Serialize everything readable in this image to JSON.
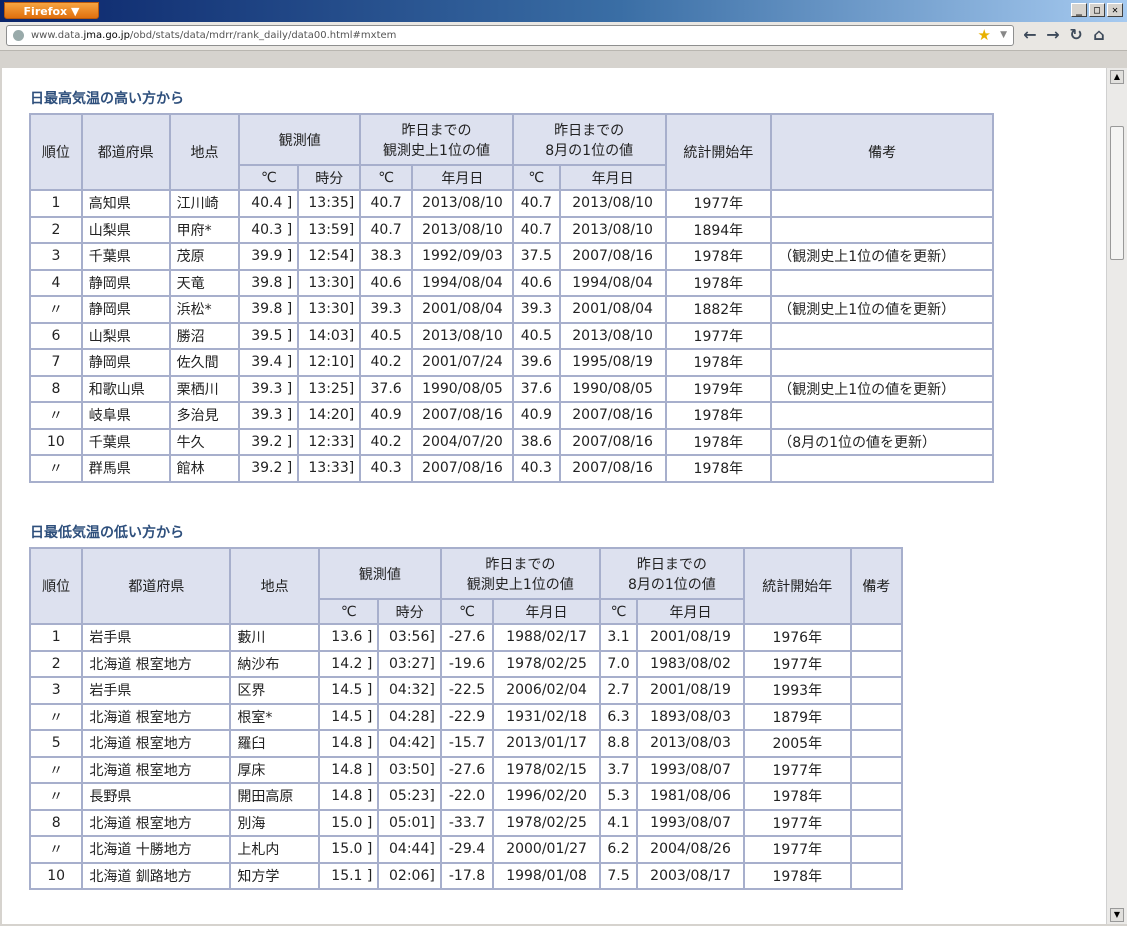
{
  "browser": {
    "button_label": "Firefox ▼",
    "window_buttons": [
      "_",
      "□",
      "✕"
    ],
    "url_prefix": "www.data.",
    "url_host": "jma.go.jp",
    "url_path": "/obd/stats/data/mdrr/rank_daily/data00.html#mxtem",
    "nav_icons": [
      "back-icon",
      "forward-icon",
      "reload-icon",
      "home-icon"
    ]
  },
  "headers": {
    "rank": "順位",
    "pref": "都道府県",
    "station": "地点",
    "observed": "観測値",
    "record_all_1": "昨日までの",
    "record_all_2": "観測史上1位の値",
    "record_aug_1": "昨日までの",
    "record_aug_2": "8月の1位の値",
    "start_year": "統計開始年",
    "remarks": "備考",
    "unit_c": "℃",
    "time": "時分",
    "date": "年月日"
  },
  "max_table": {
    "title": "日最高気温の高い方から",
    "rows": [
      {
        "rank": "1",
        "pref": "高知県",
        "station": "江川崎",
        "temp": "40.4 ]",
        "time": "13:35]",
        "rec_t": "40.7",
        "rec_d": "2013/08/10",
        "aug_t": "40.7",
        "aug_d": "2013/08/10",
        "start": "1977年",
        "note": ""
      },
      {
        "rank": "2",
        "pref": "山梨県",
        "station": "甲府*",
        "temp": "40.3 ]",
        "time": "13:59]",
        "rec_t": "40.7",
        "rec_d": "2013/08/10",
        "aug_t": "40.7",
        "aug_d": "2013/08/10",
        "start": "1894年",
        "note": ""
      },
      {
        "rank": "3",
        "pref": "千葉県",
        "station": "茂原",
        "temp": "39.9 ]",
        "time": "12:54]",
        "rec_t": "38.3",
        "rec_d": "1992/09/03",
        "aug_t": "37.5",
        "aug_d": "2007/08/16",
        "start": "1978年",
        "note": "（観測史上1位の値を更新）"
      },
      {
        "rank": "4",
        "pref": "静岡県",
        "station": "天竜",
        "temp": "39.8 ]",
        "time": "13:30]",
        "rec_t": "40.6",
        "rec_d": "1994/08/04",
        "aug_t": "40.6",
        "aug_d": "1994/08/04",
        "start": "1978年",
        "note": ""
      },
      {
        "rank": "〃",
        "pref": "静岡県",
        "station": "浜松*",
        "temp": "39.8 ]",
        "time": "13:30]",
        "rec_t": "39.3",
        "rec_d": "2001/08/04",
        "aug_t": "39.3",
        "aug_d": "2001/08/04",
        "start": "1882年",
        "note": "（観測史上1位の値を更新）"
      },
      {
        "rank": "6",
        "pref": "山梨県",
        "station": "勝沼",
        "temp": "39.5 ]",
        "time": "14:03]",
        "rec_t": "40.5",
        "rec_d": "2013/08/10",
        "aug_t": "40.5",
        "aug_d": "2013/08/10",
        "start": "1977年",
        "note": ""
      },
      {
        "rank": "7",
        "pref": "静岡県",
        "station": "佐久間",
        "temp": "39.4 ]",
        "time": "12:10]",
        "rec_t": "40.2",
        "rec_d": "2001/07/24",
        "aug_t": "39.6",
        "aug_d": "1995/08/19",
        "start": "1978年",
        "note": ""
      },
      {
        "rank": "8",
        "pref": "和歌山県",
        "station": "栗栖川",
        "temp": "39.3 ]",
        "time": "13:25]",
        "rec_t": "37.6",
        "rec_d": "1990/08/05",
        "aug_t": "37.6",
        "aug_d": "1990/08/05",
        "start": "1979年",
        "note": "（観測史上1位の値を更新）"
      },
      {
        "rank": "〃",
        "pref": "岐阜県",
        "station": "多治見",
        "temp": "39.3 ]",
        "time": "14:20]",
        "rec_t": "40.9",
        "rec_d": "2007/08/16",
        "aug_t": "40.9",
        "aug_d": "2007/08/16",
        "start": "1978年",
        "note": ""
      },
      {
        "rank": "10",
        "pref": "千葉県",
        "station": "牛久",
        "temp": "39.2 ]",
        "time": "12:33]",
        "rec_t": "40.2",
        "rec_d": "2004/07/20",
        "aug_t": "38.6",
        "aug_d": "2007/08/16",
        "start": "1978年",
        "note": "（8月の1位の値を更新）"
      },
      {
        "rank": "〃",
        "pref": "群馬県",
        "station": "館林",
        "temp": "39.2 ]",
        "time": "13:33]",
        "rec_t": "40.3",
        "rec_d": "2007/08/16",
        "aug_t": "40.3",
        "aug_d": "2007/08/16",
        "start": "1978年",
        "note": ""
      }
    ]
  },
  "min_table": {
    "title": "日最低気温の低い方から",
    "rows": [
      {
        "rank": "1",
        "pref": "岩手県",
        "station": "藪川",
        "temp": "13.6 ]",
        "time": "03:56]",
        "rec_t": "-27.6",
        "rec_d": "1988/02/17",
        "aug_t": "3.1",
        "aug_d": "2001/08/19",
        "start": "1976年",
        "note": ""
      },
      {
        "rank": "2",
        "pref": "北海道 根室地方",
        "station": "納沙布",
        "temp": "14.2 ]",
        "time": "03:27]",
        "rec_t": "-19.6",
        "rec_d": "1978/02/25",
        "aug_t": "7.0",
        "aug_d": "1983/08/02",
        "start": "1977年",
        "note": ""
      },
      {
        "rank": "3",
        "pref": "岩手県",
        "station": "区界",
        "temp": "14.5 ]",
        "time": "04:32]",
        "rec_t": "-22.5",
        "rec_d": "2006/02/04",
        "aug_t": "2.7",
        "aug_d": "2001/08/19",
        "start": "1993年",
        "note": ""
      },
      {
        "rank": "〃",
        "pref": "北海道 根室地方",
        "station": "根室*",
        "temp": "14.5 ]",
        "time": "04:28]",
        "rec_t": "-22.9",
        "rec_d": "1931/02/18",
        "aug_t": "6.3",
        "aug_d": "1893/08/03",
        "start": "1879年",
        "note": ""
      },
      {
        "rank": "5",
        "pref": "北海道 根室地方",
        "station": "羅臼",
        "temp": "14.8 ]",
        "time": "04:42]",
        "rec_t": "-15.7",
        "rec_d": "2013/01/17",
        "aug_t": "8.8",
        "aug_d": "2013/08/03",
        "start": "2005年",
        "note": ""
      },
      {
        "rank": "〃",
        "pref": "北海道 根室地方",
        "station": "厚床",
        "temp": "14.8 ]",
        "time": "03:50]",
        "rec_t": "-27.6",
        "rec_d": "1978/02/15",
        "aug_t": "3.7",
        "aug_d": "1993/08/07",
        "start": "1977年",
        "note": ""
      },
      {
        "rank": "〃",
        "pref": "長野県",
        "station": "開田高原",
        "temp": "14.8 ]",
        "time": "05:23]",
        "rec_t": "-22.0",
        "rec_d": "1996/02/20",
        "aug_t": "5.3",
        "aug_d": "1981/08/06",
        "start": "1978年",
        "note": ""
      },
      {
        "rank": "8",
        "pref": "北海道 根室地方",
        "station": "別海",
        "temp": "15.0 ]",
        "time": "05:01]",
        "rec_t": "-33.7",
        "rec_d": "1978/02/25",
        "aug_t": "4.1",
        "aug_d": "1993/08/07",
        "start": "1977年",
        "note": ""
      },
      {
        "rank": "〃",
        "pref": "北海道 十勝地方",
        "station": "上札内",
        "temp": "15.0 ]",
        "time": "04:44]",
        "rec_t": "-29.4",
        "rec_d": "2000/01/27",
        "aug_t": "6.2",
        "aug_d": "2004/08/26",
        "start": "1977年",
        "note": ""
      },
      {
        "rank": "10",
        "pref": "北海道 釧路地方",
        "station": "知方学",
        "temp": "15.1 ]",
        "time": "02:06]",
        "rec_t": "-17.8",
        "rec_d": "1998/01/08",
        "aug_t": "7.5",
        "aug_d": "2003/08/17",
        "start": "1978年",
        "note": ""
      }
    ]
  }
}
